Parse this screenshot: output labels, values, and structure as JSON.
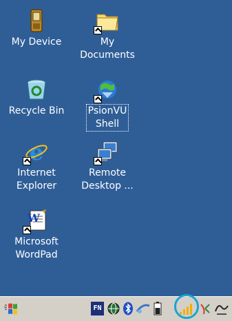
{
  "desktop": {
    "icons": [
      {
        "label": "My Device",
        "icon": "pda-device-icon"
      },
      {
        "label": "My\nDocuments",
        "icon": "folder-icon"
      },
      {
        "label": "Recycle Bin",
        "icon": "recycle-bin-icon"
      },
      {
        "label": "PsionVU\nShell",
        "icon": "psionvu-shell-icon"
      },
      {
        "label": "Internet\nExplorer",
        "icon": "internet-explorer-icon"
      },
      {
        "label": "Remote\nDesktop ...",
        "icon": "remote-desktop-icon"
      },
      {
        "label": "Microsoft\nWordPad",
        "icon": "wordpad-icon"
      }
    ]
  },
  "taskbar": {
    "start": "windows-flag-icon",
    "tray": [
      {
        "name": "fn-key-icon",
        "text": "FN"
      },
      {
        "name": "network-globe-icon"
      },
      {
        "name": "bluetooth-icon"
      },
      {
        "name": "connectivity-icon"
      },
      {
        "name": "battery-icon"
      },
      {
        "name": "signal-strength-icon"
      },
      {
        "name": "wireless-status-icon"
      },
      {
        "name": "input-panel-icon"
      }
    ]
  },
  "colors": {
    "desktop": "#2f5e97",
    "taskbar": "#d4d0c8",
    "highlight_ring": "#19a4d4"
  }
}
